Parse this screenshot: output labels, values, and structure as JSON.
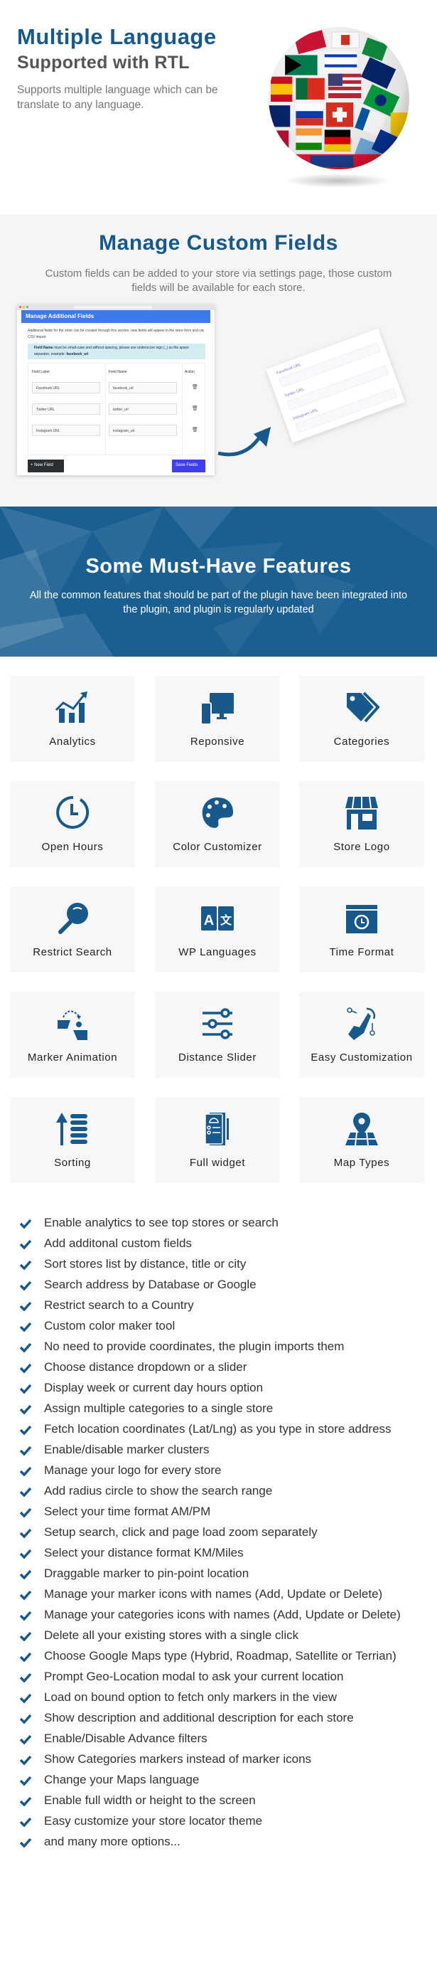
{
  "language_section": {
    "title": "Multiple Language",
    "subtitle": "Supported with RTL",
    "description": "Supports multiple language which can be translate to any language.",
    "image": "flag-globe"
  },
  "custom_fields": {
    "title": "Manage Custom Fields",
    "description": "Custom fields can be added to your store via settings page, those custom fields will be available for each store.",
    "mock": {
      "header": "Manage Additional Fields",
      "description": "Additional fields for the store can be created through this section, new fields will appear in the store form and via CSV import.",
      "info_bold": "Field Name",
      "info": " must be small-case and without spacing, please use underscore sign (_) as the space separator, example: ",
      "info_example": "facebook_url",
      "columns": [
        "Field Label",
        "Field Name",
        "Action"
      ],
      "rows": [
        {
          "label": "Facebook URL",
          "name": "facebook_url"
        },
        {
          "label": "Twitter URL",
          "name": "twitter_url"
        },
        {
          "label": "Instagram URL",
          "name": "instagram_url"
        }
      ],
      "new_button": "+ New Field",
      "save_button": "Save Fields"
    },
    "preview_labels": [
      "Facebook URL",
      "Twitter URL",
      "Instagram URL"
    ]
  },
  "features_banner": {
    "title": "Some Must-Have Features",
    "subtitle": "All the common features that should be part of the plugin have been integrated into the plugin, and plugin is regularly updated"
  },
  "feature_cards": [
    {
      "label": "Analytics",
      "icon": "chart-icon"
    },
    {
      "label": "Reponsive",
      "icon": "devices-icon"
    },
    {
      "label": "Categories",
      "icon": "tags-icon"
    },
    {
      "label": "Open Hours",
      "icon": "clock-icon"
    },
    {
      "label": "Color Customizer",
      "icon": "palette-icon"
    },
    {
      "label": "Store Logo",
      "icon": "store-icon"
    },
    {
      "label": "Restrict Search",
      "icon": "search-icon"
    },
    {
      "label": "WP Languages",
      "icon": "translate-icon"
    },
    {
      "label": "Time Format",
      "icon": "window-clock-icon"
    },
    {
      "label": "Marker Animation",
      "icon": "marker-animation-icon"
    },
    {
      "label": "Distance Slider",
      "icon": "sliders-icon"
    },
    {
      "label": "Easy Customization",
      "icon": "hand-tap-icon"
    },
    {
      "label": "Sorting",
      "icon": "sort-icon"
    },
    {
      "label": "Full widget",
      "icon": "widget-icon"
    },
    {
      "label": "Map Types",
      "icon": "map-pin-icon"
    }
  ],
  "feature_list": [
    "Enable analytics to see top stores or search",
    "Add additonal custom fields",
    "Sort stores list by distance, title or city",
    "Search address by Database or Google",
    "Restrict search to a Country",
    "Custom color maker tool",
    "No need to provide coordinates, the plugin imports them",
    "Choose distance dropdown or a slider",
    "Display week or current day hours option",
    "Assign multiple categories to a single store",
    "Fetch location coordinates (Lat/Lng) as you type in store address",
    "Enable/disable marker clusters",
    "Manage your logo for every store",
    "Add radius circle to show the search range",
    "Select your time format AM/PM",
    "Setup search, click and page load zoom separately",
    "Select your distance format KM/Miles",
    "Draggable marker to pin-point location",
    "Manage your marker icons with names (Add, Update or Delete)",
    "Manage your categories icons with names (Add, Update or Delete)",
    "Delete all your existing stores with a single click",
    "Choose Google Maps type (Hybrid, Roadmap, Satellite or Terrian)",
    "Prompt Geo-Location modal to ask your current location",
    "Load on bound option to fetch only markers in the view",
    "Show description and additional description for each store",
    "Enable/Disable Advance filters",
    "Show Categories markers instead of marker icons",
    "Change your Maps language",
    "Enable full width or height to the screen",
    "Easy customize your store locator theme",
    "and many more options..."
  ],
  "colors": {
    "brand": "#17598c",
    "banner": "#1a5f92",
    "card": "#f7f7f7",
    "section_gray": "#f5f5f5"
  }
}
